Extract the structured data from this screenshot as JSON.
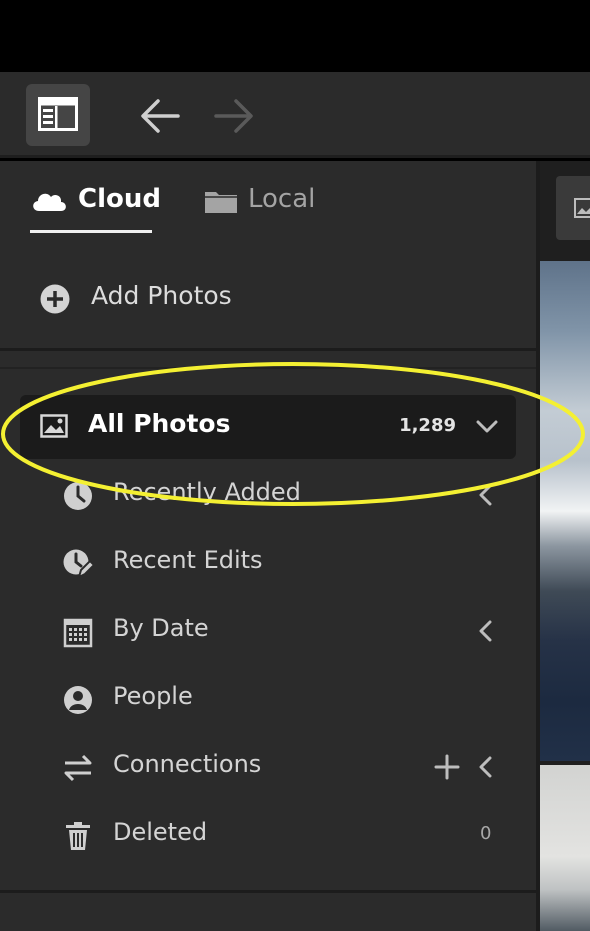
{
  "colors": {
    "highlight": "#f4f032",
    "panel": "#2b2b2b",
    "selected_row": "#1b1b1b"
  },
  "toolbar": {
    "panel_toggle_icon": "panel-toggle-icon",
    "back_icon": "arrow-left-icon",
    "forward_icon": "arrow-right-icon"
  },
  "tabs": [
    {
      "label": "Cloud",
      "icon": "cloud-icon",
      "active": true
    },
    {
      "label": "Local",
      "icon": "folder-icon",
      "active": false
    }
  ],
  "add_photos": {
    "label": "Add Photos",
    "icon": "plus-circle-icon"
  },
  "all_photos": {
    "label": "All Photos",
    "count": "1,289",
    "icon": "image-icon"
  },
  "nav_items": [
    {
      "label": "Recently Added",
      "icon": "clock-icon"
    },
    {
      "label": "Recent Edits",
      "icon": "clock-edit-icon"
    },
    {
      "label": "By Date",
      "icon": "calendar-icon"
    },
    {
      "label": "People",
      "icon": "person-icon"
    },
    {
      "label": "Connections",
      "icon": "swap-icon"
    },
    {
      "label": "Deleted",
      "icon": "trash-icon",
      "count": "0"
    }
  ]
}
